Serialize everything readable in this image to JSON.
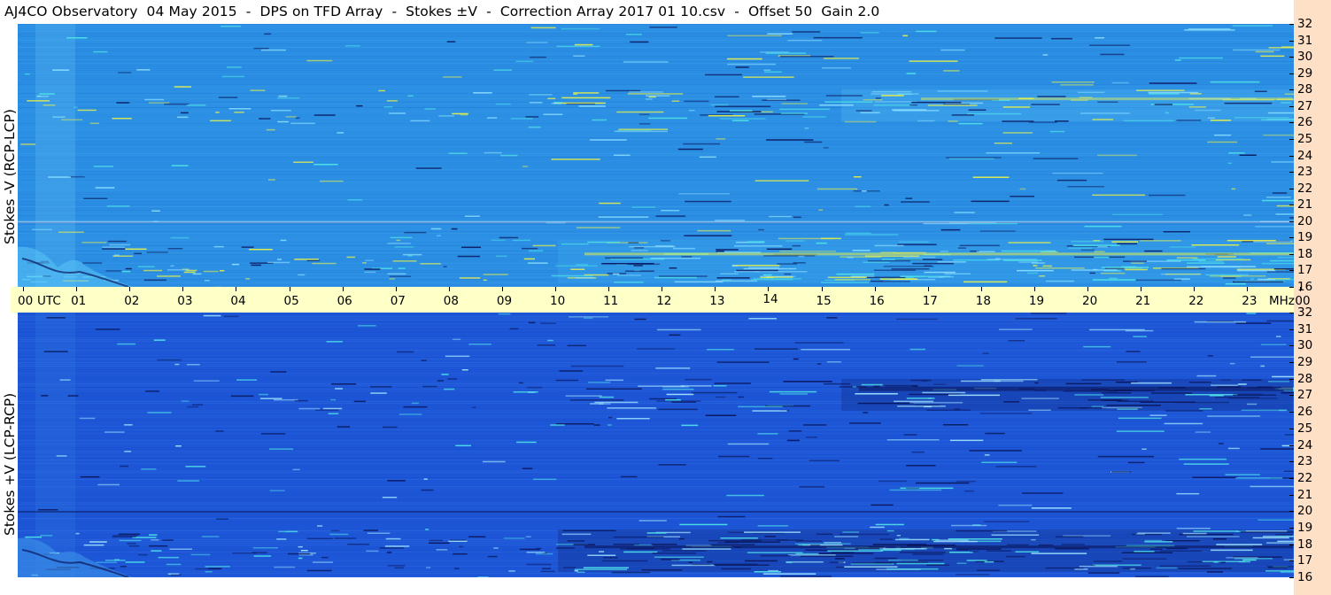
{
  "title": "AJ4CO Observatory  04 May 2015  -  DPS on TFD Array  -  Stokes ±V  -  Correction Array 2017 01 10.csv  -  Offset 50  Gain 2.0",
  "colors": {
    "background": "#ffffff",
    "right_strip": "#fde0c6",
    "time_axis_band": "#ffffc8",
    "top_panel_base": "#2b8fe3",
    "bottom_panel_base": "#1d56d6",
    "highlight_yellow": "#e8f04a",
    "highlight_cyan": "#4fe3e8",
    "dark_line": "#0a1a60",
    "red_line": "#d0406a"
  },
  "time_axis": {
    "unit": "UTC",
    "freq_unit": "MHz",
    "labels": [
      "00",
      "01",
      "02",
      "03",
      "04",
      "05",
      "06",
      "07",
      "08",
      "09",
      "10",
      "11",
      "12",
      "13",
      "14",
      "15",
      "16",
      "17",
      "18",
      "19",
      "20",
      "21",
      "22",
      "23",
      "00"
    ]
  },
  "panels": [
    {
      "side_label": "Stokes -V (RCP-LCP)",
      "freq_labels": [
        "32",
        "31",
        "30",
        "29",
        "28",
        "27",
        "26",
        "25",
        "24",
        "23",
        "22",
        "21",
        "20",
        "19",
        "18",
        "17",
        "16"
      ]
    },
    {
      "side_label": "Stokes +V (LCP-RCP)",
      "freq_labels": [
        "32",
        "31",
        "30",
        "29",
        "28",
        "27",
        "26",
        "25",
        "24",
        "23",
        "22",
        "21",
        "20",
        "19",
        "18",
        "17",
        "16"
      ]
    }
  ],
  "chart_data": {
    "type": "heatmap",
    "title": "AJ4CO Observatory  04 May 2015  -  DPS on TFD Array  -  Stokes ±V  -  Correction Array 2017 01 10.csv  -  Offset 50  Gain 2.0",
    "x_axis": {
      "label": "UTC",
      "range_hours": [
        0,
        24
      ],
      "ticks": [
        "00",
        "01",
        "02",
        "03",
        "04",
        "05",
        "06",
        "07",
        "08",
        "09",
        "10",
        "11",
        "12",
        "13",
        "14",
        "15",
        "16",
        "17",
        "18",
        "19",
        "20",
        "21",
        "22",
        "23",
        "00"
      ]
    },
    "y_axis": {
      "label": "MHz",
      "range_mhz": [
        16,
        32
      ],
      "ticks": [
        32,
        31,
        30,
        29,
        28,
        27,
        26,
        25,
        24,
        23,
        22,
        21,
        20,
        19,
        18,
        17,
        16
      ]
    },
    "series": [
      {
        "name": "Stokes -V (RCP-LCP)"
      },
      {
        "name": "Stokes +V (LCP-RCP)"
      }
    ]
  }
}
